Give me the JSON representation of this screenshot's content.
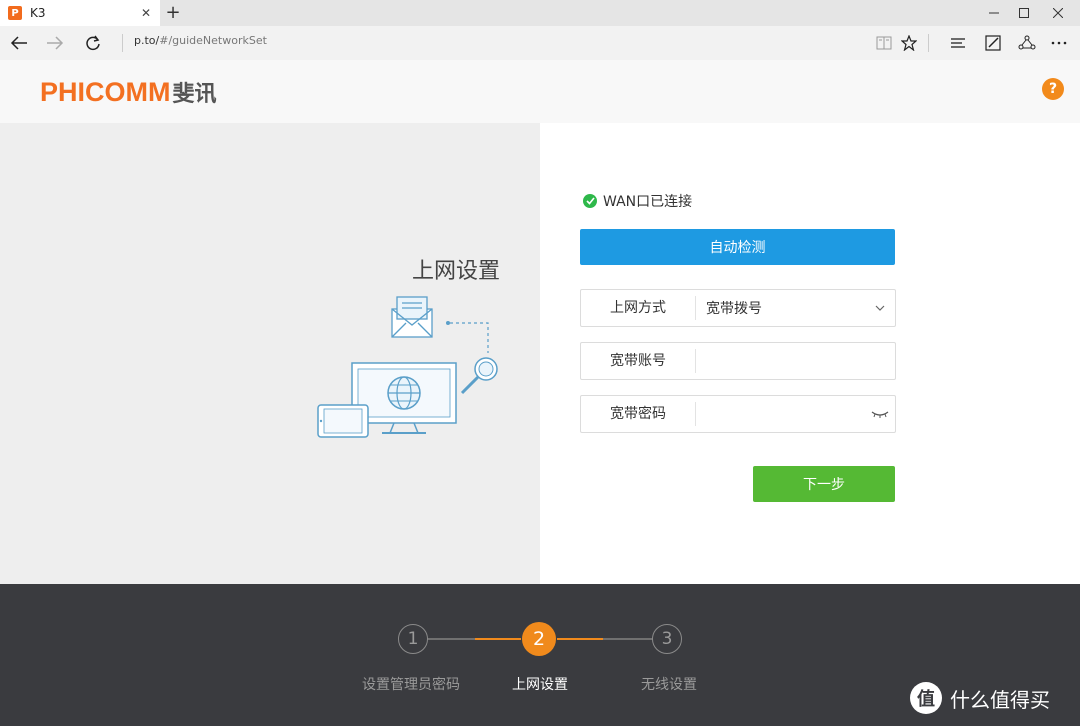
{
  "browser": {
    "tab_title": "K3",
    "favicon_letter": "P",
    "new_tab_symbol": "+",
    "close_symbol": "✕",
    "address_host": "p.to/",
    "address_path": "#/guideNetworkSet"
  },
  "header": {
    "logo_en": "PHICOMM",
    "logo_cn": "斐讯",
    "help_label": "?",
    "brand_color": "#f37021"
  },
  "left": {
    "title": "上网设置"
  },
  "form": {
    "wan_status": "WAN口已连接",
    "detect_button": "自动检测",
    "method_label": "上网方式",
    "method_value": "宽带拨号",
    "account_label": "宽带账号",
    "account_value": "",
    "password_label": "宽带密码",
    "password_value": "",
    "next_button": "下一步"
  },
  "steps": [
    {
      "number": "1",
      "label": "设置管理员密码",
      "state": "done"
    },
    {
      "number": "2",
      "label": "上网设置",
      "state": "active"
    },
    {
      "number": "3",
      "label": "无线设置",
      "state": "todo"
    }
  ],
  "watermark": {
    "logo": "值",
    "text": "什么值得买"
  },
  "colors": {
    "detect": "#1e9ae2",
    "next": "#55b934",
    "step_active": "#f08a1c",
    "status_ok": "#2eb84a"
  }
}
